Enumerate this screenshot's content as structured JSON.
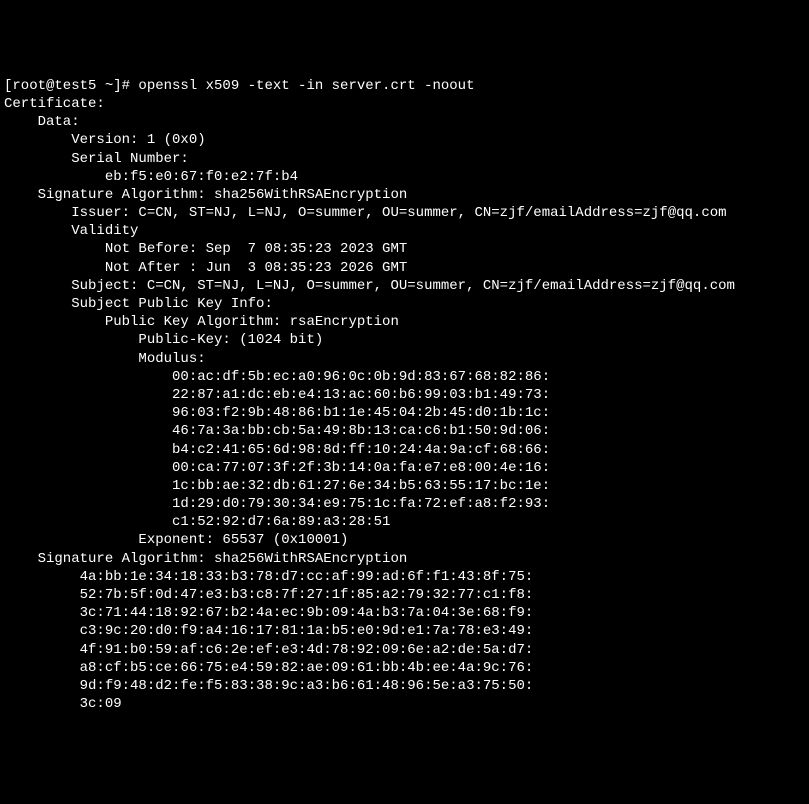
{
  "terminal": {
    "prompt": "[root@test5 ~]# ",
    "command": "openssl x509 -text -in server.crt -noout",
    "lines": [
      "Certificate:",
      "    Data:",
      "        Version: 1 (0x0)",
      "        Serial Number:",
      "            eb:f5:e0:67:f0:e2:7f:b4",
      "    Signature Algorithm: sha256WithRSAEncryption",
      "        Issuer: C=CN, ST=NJ, L=NJ, O=summer, OU=summer, CN=zjf/emailAddress=zjf@qq.com",
      "        Validity",
      "            Not Before: Sep  7 08:35:23 2023 GMT",
      "            Not After : Jun  3 08:35:23 2026 GMT",
      "        Subject: C=CN, ST=NJ, L=NJ, O=summer, OU=summer, CN=zjf/emailAddress=zjf@qq.com",
      "        Subject Public Key Info:",
      "            Public Key Algorithm: rsaEncryption",
      "                Public-Key: (1024 bit)",
      "                Modulus:",
      "                    00:ac:df:5b:ec:a0:96:0c:0b:9d:83:67:68:82:86:",
      "                    22:87:a1:dc:eb:e4:13:ac:60:b6:99:03:b1:49:73:",
      "                    96:03:f2:9b:48:86:b1:1e:45:04:2b:45:d0:1b:1c:",
      "                    46:7a:3a:bb:cb:5a:49:8b:13:ca:c6:b1:50:9d:06:",
      "                    b4:c2:41:65:6d:98:8d:ff:10:24:4a:9a:cf:68:66:",
      "                    00:ca:77:07:3f:2f:3b:14:0a:fa:e7:e8:00:4e:16:",
      "                    1c:bb:ae:32:db:61:27:6e:34:b5:63:55:17:bc:1e:",
      "                    1d:29:d0:79:30:34:e9:75:1c:fa:72:ef:a8:f2:93:",
      "                    c1:52:92:d7:6a:89:a3:28:51",
      "                Exponent: 65537 (0x10001)",
      "    Signature Algorithm: sha256WithRSAEncryption",
      "         4a:bb:1e:34:18:33:b3:78:d7:cc:af:99:ad:6f:f1:43:8f:75:",
      "         52:7b:5f:0d:47:e3:b3:c8:7f:27:1f:85:a2:79:32:77:c1:f8:",
      "         3c:71:44:18:92:67:b2:4a:ec:9b:09:4a:b3:7a:04:3e:68:f9:",
      "         c3:9c:20:d0:f9:a4:16:17:81:1a:b5:e0:9d:e1:7a:78:e3:49:",
      "         4f:91:b0:59:af:c6:2e:ef:e3:4d:78:92:09:6e:a2:de:5a:d7:",
      "         a8:cf:b5:ce:66:75:e4:59:82:ae:09:61:bb:4b:ee:4a:9c:76:",
      "         9d:f9:48:d2:fe:f5:83:38:9c:a3:b6:61:48:96:5e:a3:75:50:",
      "         3c:09"
    ]
  }
}
